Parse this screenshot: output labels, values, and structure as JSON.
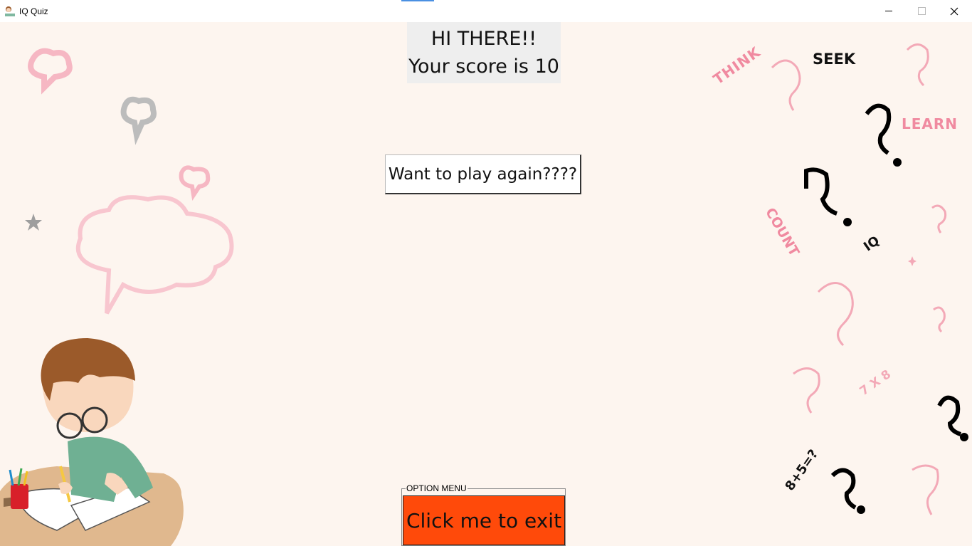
{
  "window": {
    "title": "IQ Quiz",
    "icon": "student-icon"
  },
  "score_panel": {
    "greeting": "HI THERE!!",
    "score_text": "Your score is 10"
  },
  "play_again": {
    "label": "Want to play again????"
  },
  "option_menu": {
    "legend": "OPTION MENU",
    "exit_label": "Click me to exit"
  },
  "decor_words": {
    "think": "THINK",
    "seek": "SEEK",
    "learn": "LEARN",
    "count": "COUNT",
    "iq": "IQ",
    "times": "7 X 8",
    "sum": "8+5=?"
  },
  "colors": {
    "background": "#fdf5ef",
    "exit_button": "#ff4a0a",
    "score_panel": "#eeeeee",
    "pink": "#f2a6b3"
  }
}
